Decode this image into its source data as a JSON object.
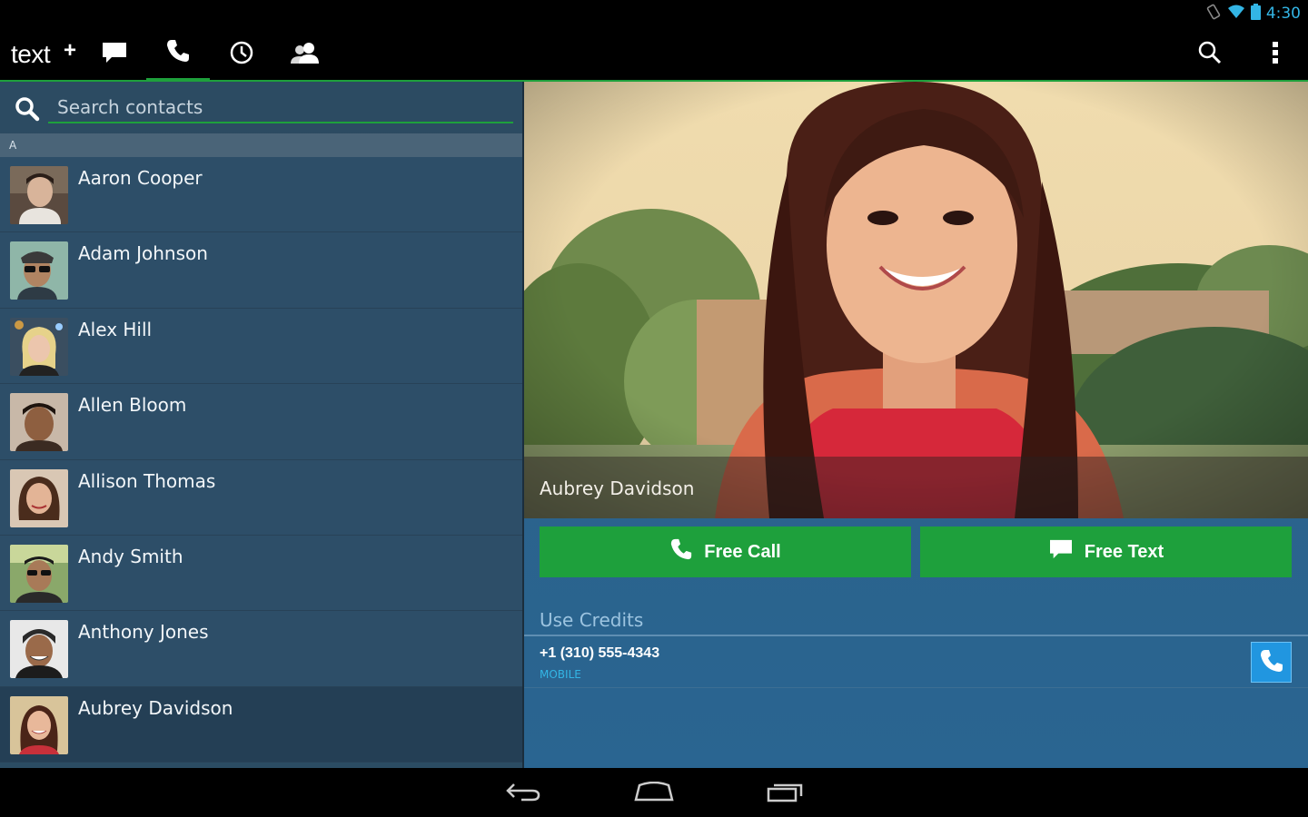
{
  "status_bar": {
    "time": "4:30",
    "icons": [
      "rotation-lock-icon",
      "wifi-icon",
      "battery-icon"
    ]
  },
  "action_bar": {
    "logo_text": "text",
    "logo_plus": "+",
    "tabs": [
      {
        "id": "messages",
        "icon": "chat-bubble-icon",
        "active": false
      },
      {
        "id": "calls",
        "icon": "phone-icon",
        "active": true
      },
      {
        "id": "history",
        "icon": "clock-icon",
        "active": false
      },
      {
        "id": "contacts",
        "icon": "contacts-icon",
        "active": false
      }
    ],
    "right_icons": [
      "search-icon",
      "overflow-menu-icon"
    ]
  },
  "left_panel": {
    "search": {
      "placeholder": "Search contacts",
      "value": ""
    },
    "section_header": "A",
    "contacts": [
      {
        "name": "Aaron Cooper",
        "selected": false
      },
      {
        "name": "Adam Johnson",
        "selected": false
      },
      {
        "name": "Alex Hill",
        "selected": false
      },
      {
        "name": "Allen Bloom",
        "selected": false
      },
      {
        "name": "Allison Thomas",
        "selected": false
      },
      {
        "name": "Andy Smith",
        "selected": false
      },
      {
        "name": "Anthony Jones",
        "selected": false
      },
      {
        "name": "Aubrey Davidson",
        "selected": true
      }
    ]
  },
  "detail": {
    "name": "Aubrey Davidson",
    "free_call_label": "Free Call",
    "free_text_label": "Free Text",
    "credits_label": "Use Credits",
    "phone": {
      "number": "+1 (310) 555-4343",
      "type": "MOBILE"
    }
  },
  "colors": {
    "accent_green": "#1ea03c",
    "holo_blue": "#33b5e5",
    "panel_left": "#2d4e68",
    "panel_right": "#2a6591"
  },
  "nav_bar": {
    "buttons": [
      "back-icon",
      "home-icon",
      "recent-apps-icon"
    ]
  }
}
